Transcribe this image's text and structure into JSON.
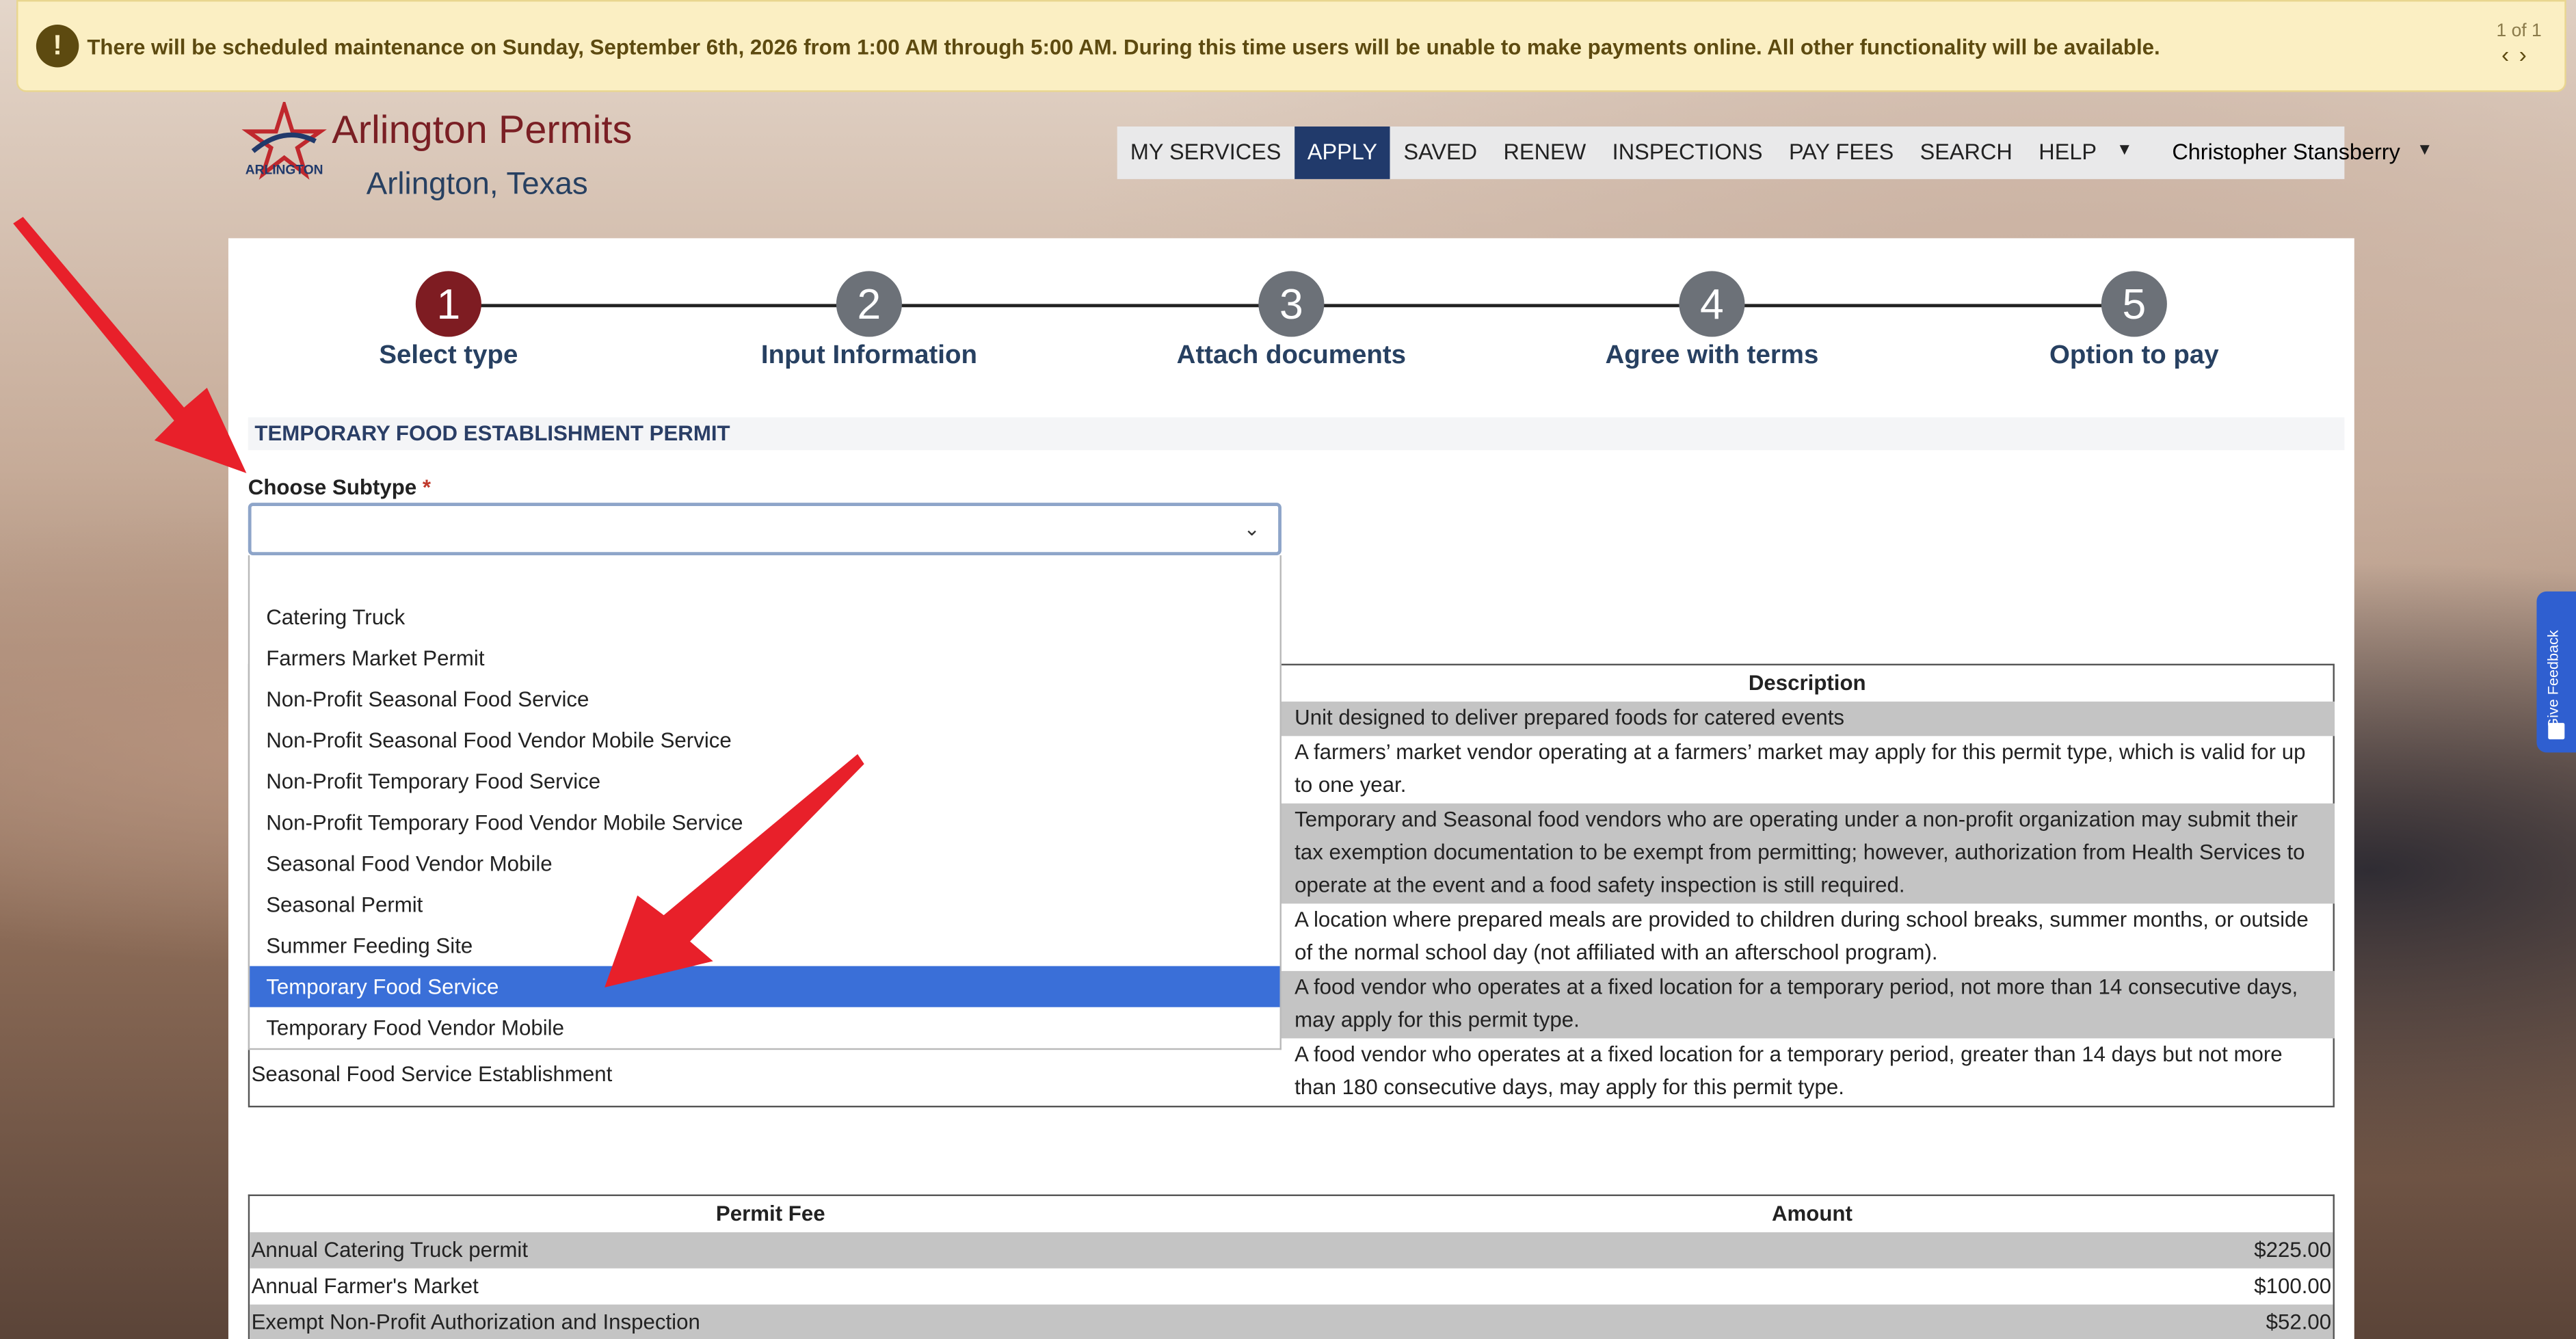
{
  "banner": {
    "message": "There will be scheduled maintenance on Sunday, September 6th, 2026 from 1:00 AM through 5:00 AM. During this time users will be unable to make payments online. All other functionality will be available.",
    "pager": "1 of 1",
    "icon": "exclamation-icon"
  },
  "brand": {
    "title": "Arlington Permits",
    "city": "Arlington, Texas",
    "logo_text": "ARLINGTON"
  },
  "nav": {
    "items": [
      "MY SERVICES",
      "APPLY",
      "SAVED",
      "RENEW",
      "INSPECTIONS",
      "PAY FEES",
      "SEARCH",
      "HELP"
    ],
    "active": "APPLY",
    "user": "Christopher Stansberry"
  },
  "steps": [
    {
      "num": "1",
      "label": "Select type"
    },
    {
      "num": "2",
      "label": "Input Information"
    },
    {
      "num": "3",
      "label": "Attach documents"
    },
    {
      "num": "4",
      "label": "Agree with terms"
    },
    {
      "num": "5",
      "label": "Option to pay"
    }
  ],
  "section_title": "TEMPORARY FOOD ESTABLISHMENT PERMIT",
  "subtype": {
    "label": "Choose Subtype",
    "required_mark": "*",
    "value": ""
  },
  "dropdown_options": [
    "Catering Truck",
    "Farmers Market Permit",
    "Non-Profit Seasonal Food Service",
    "Non-Profit Seasonal Food Vendor Mobile Service",
    "Non-Profit Temporary Food Service",
    "Non-Profit Temporary Food Vendor Mobile Service",
    "Seasonal Food Vendor Mobile",
    "Seasonal Permit",
    "Summer Feeding Site",
    "Temporary Food Service",
    "Temporary Food Vendor Mobile"
  ],
  "dropdown_selected": "Temporary Food Service",
  "description_table": {
    "header": "Description",
    "rows": [
      "Unit designed to deliver prepared foods for catered events",
      "A farmers’ market vendor operating at a farmers’ market may apply for this permit type, which is valid for up to one year.",
      "Temporary and Seasonal food vendors who are operating under a non-profit organization may submit their tax exemption documentation to be exempt from permitting; however, authorization from Health Services to operate at the event and a food safety inspection is still required.",
      "A location where prepared meals are provided to children during school breaks, summer months, or outside of the normal school day (not affiliated with an afterschool program).",
      "A food vendor who operates at a fixed location for a temporary period, not more than 14 consecutive days, may apply for this permit type.",
      "A food vendor who operates at a fixed location for a temporary period, greater than 14 days but not more than 180 consecutive days, may apply for this permit type."
    ],
    "last_left_cell": "Seasonal Food Service Establishment"
  },
  "fee_table": {
    "headers": [
      "Permit Fee",
      "Amount"
    ],
    "rows": [
      {
        "name": "Annual Catering Truck permit",
        "amount": "$225.00"
      },
      {
        "name": "Annual Farmer's Market",
        "amount": "$100.00"
      },
      {
        "name": "Exempt Non-Profit Authorization and Inspection",
        "amount": "$52.00"
      }
    ]
  },
  "feedback": {
    "label": "Give Feedback"
  },
  "colors": {
    "banner_bg": "#fbefc3",
    "nav_active": "#213a6b",
    "step_current": "#7e1c22",
    "step_default": "#6c7178",
    "option_selected": "#3a6fd8",
    "arrow": "#e8202a",
    "feedback": "#2f5fd0"
  }
}
